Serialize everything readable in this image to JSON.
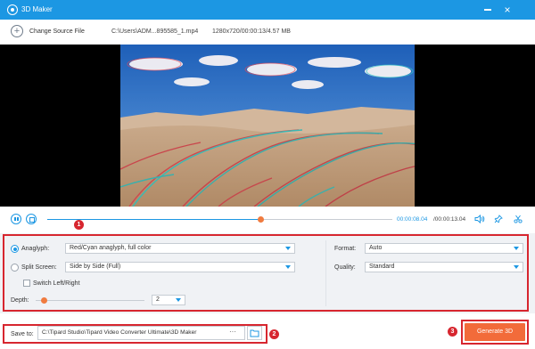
{
  "titlebar": {
    "title": "3D Maker",
    "close": "×"
  },
  "source": {
    "change_label": "Change Source File",
    "file_path": "C:\\Users\\ADM...895585_1.mp4",
    "file_info": "1280x720/00:00:13/4.57 MB"
  },
  "player": {
    "current_time": "00:00:08.04",
    "separator_total": "/00:00:13.04",
    "progress_fraction": 0.62,
    "badge": "1"
  },
  "settings": {
    "anaglyph_label": "Anaglyph:",
    "anaglyph_value": "Red/Cyan anaglyph, full color",
    "split_label": "Split Screen:",
    "split_value": "Side by Side (Full)",
    "switch_label": "Switch Left/Right",
    "depth_label": "Depth:",
    "depth_value": "2",
    "depth_fraction": 0.08,
    "format_label": "Format:",
    "format_value": "Auto",
    "quality_label": "Quality:",
    "quality_value": "Standard"
  },
  "save": {
    "label": "Save to:",
    "path": "C:\\Tipard Studio\\Tipard Video Converter Ultimate\\3D Maker",
    "dots": "···",
    "badge": "2"
  },
  "generate": {
    "label": "Generate 3D",
    "badge": "3"
  },
  "colors": {
    "accent": "#1c97e3",
    "generate": "#f26b3a",
    "highlight": "#d7262f",
    "knob": "#f07b3f"
  }
}
